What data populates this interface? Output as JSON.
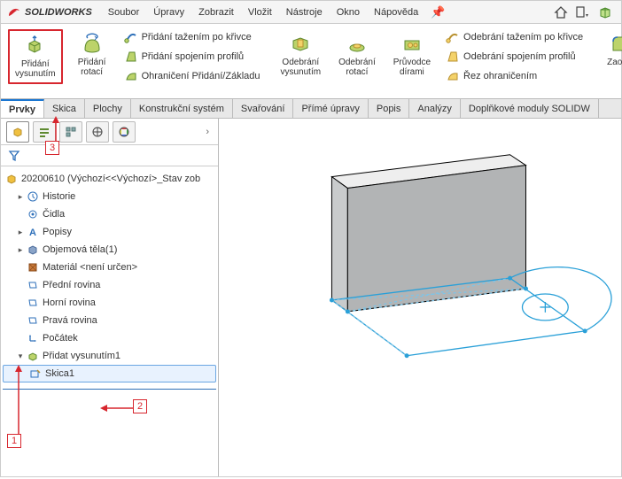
{
  "app": {
    "name": "SOLIDWORKS"
  },
  "menu": {
    "items": [
      "Soubor",
      "Úpravy",
      "Zobrazit",
      "Vložit",
      "Nástroje",
      "Okno",
      "Nápověda"
    ]
  },
  "ribbon": {
    "extrude": {
      "label": "Přidání vysunutím"
    },
    "revolve": {
      "label": "Přidání rotací"
    },
    "sweep": {
      "label": "Přidání tažením po křivce"
    },
    "loft": {
      "label": "Přidání spojením profilů"
    },
    "boundary": {
      "label": "Ohraničení Přidání/Základu"
    },
    "cut_extrude": {
      "label": "Odebrání vysunutím"
    },
    "cut_revolve": {
      "label": "Odebrání rotací"
    },
    "hole_wizard": {
      "label": "Průvodce dírami"
    },
    "cut_sweep": {
      "label": "Odebrání tažením po křivce"
    },
    "cut_loft": {
      "label": "Odebrání spojením profilů"
    },
    "cut_boundary": {
      "label": "Řez ohraničením"
    },
    "fillet": {
      "label": "Zaoblit"
    }
  },
  "tabs": [
    "Prvky",
    "Skica",
    "Plochy",
    "Konstrukční systém",
    "Svařování",
    "Přímé úpravy",
    "Popis",
    "Analýzy",
    "Doplňkové moduly SOLIDW"
  ],
  "tree": {
    "root": "20200610 (Výchozí<<Výchozí>_Stav zob",
    "history": "Historie",
    "sensors": "Čidla",
    "annotations": "Popisy",
    "bodies": "Objemová těla(1)",
    "material": "Materiál <není určen>",
    "front": "Přední rovina",
    "top": "Horní rovina",
    "right": "Pravá rovina",
    "origin": "Počátek",
    "feat1": "Přidat vysunutím1",
    "sketch1": "Skica1"
  },
  "annotations": {
    "n1": "1",
    "n2": "2",
    "n3": "3"
  }
}
